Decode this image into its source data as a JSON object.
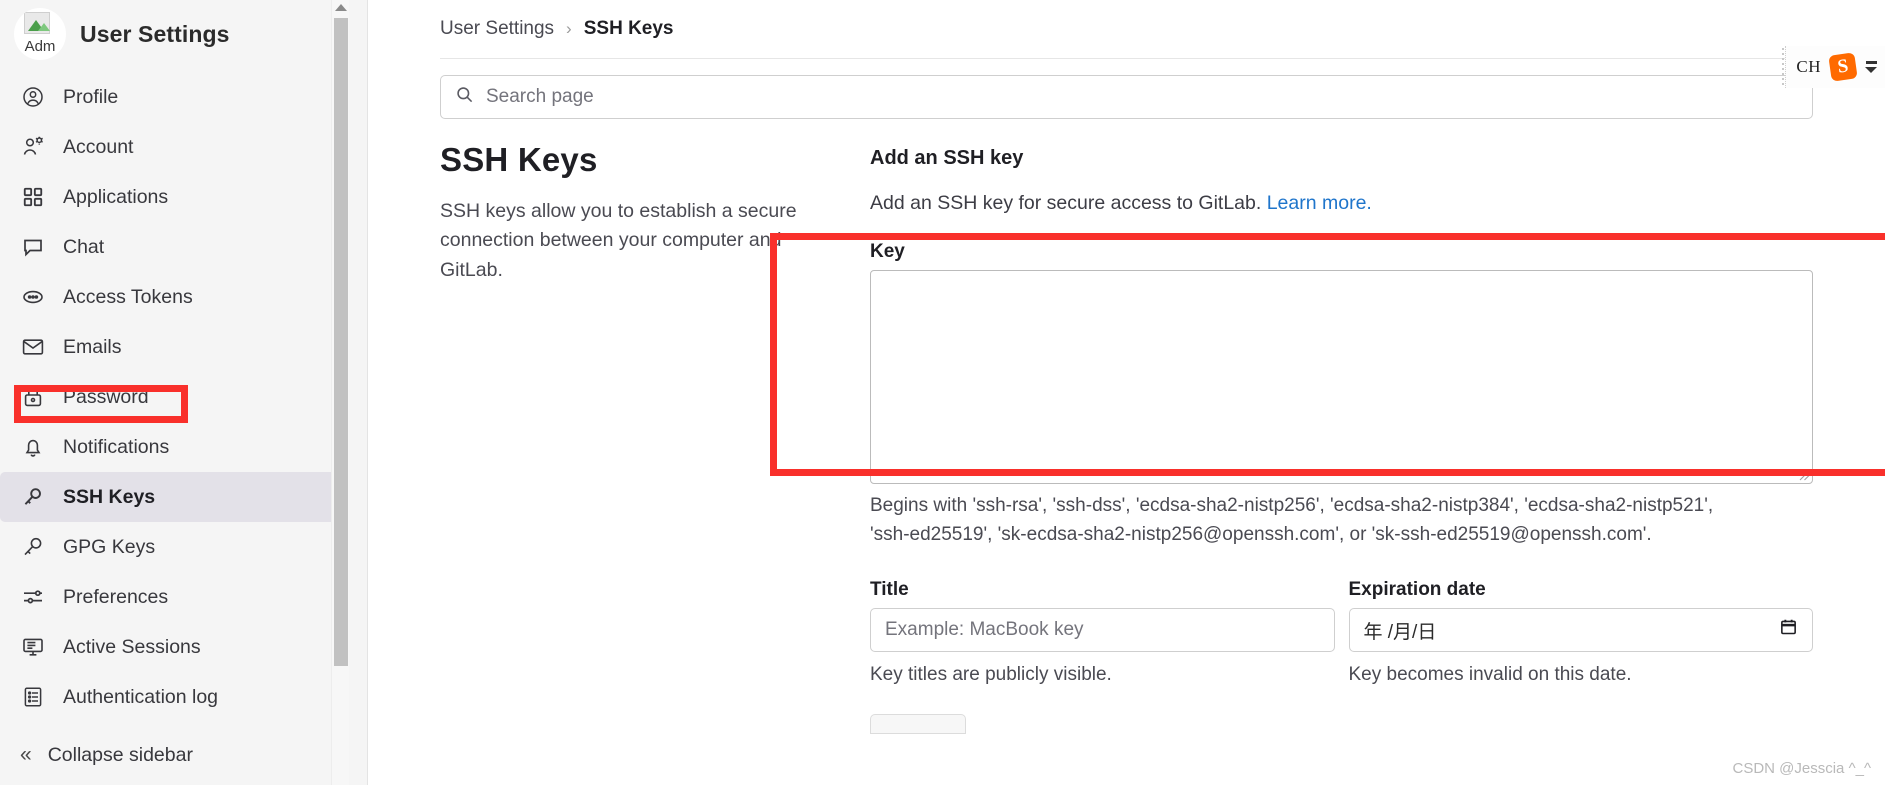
{
  "sidebar": {
    "avatar_alt": "Adm",
    "title": "User Settings",
    "items": [
      {
        "label": "Profile",
        "icon": "user-circle-icon",
        "active": false
      },
      {
        "label": "Account",
        "icon": "user-gear-icon",
        "active": false
      },
      {
        "label": "Applications",
        "icon": "grid-apps-icon",
        "active": false
      },
      {
        "label": "Chat",
        "icon": "chat-bubble-icon",
        "active": false
      },
      {
        "label": "Access Tokens",
        "icon": "token-icon",
        "active": false
      },
      {
        "label": "Emails",
        "icon": "envelope-icon",
        "active": false
      },
      {
        "label": "Password",
        "icon": "lock-icon",
        "active": false
      },
      {
        "label": "Notifications",
        "icon": "bell-icon",
        "active": false
      },
      {
        "label": "SSH Keys",
        "icon": "key-icon",
        "active": true
      },
      {
        "label": "GPG Keys",
        "icon": "key-icon",
        "active": false
      },
      {
        "label": "Preferences",
        "icon": "sliders-icon",
        "active": false
      },
      {
        "label": "Active Sessions",
        "icon": "monitor-icon",
        "active": false
      },
      {
        "label": "Authentication log",
        "icon": "list-doc-icon",
        "active": false
      }
    ],
    "collapse_label": "Collapse sidebar",
    "collapse_icon": "chevron-double-left-icon"
  },
  "breadcrumb": {
    "parent": "User Settings",
    "separator": "›",
    "current": "SSH Keys"
  },
  "search": {
    "placeholder": "Search page",
    "icon": "search-icon",
    "value": ""
  },
  "overview": {
    "title": "SSH Keys",
    "description": "SSH keys allow you to establish a secure connection between your computer and GitLab."
  },
  "add_key": {
    "section_title": "Add an SSH key",
    "section_desc": "Add an SSH key for secure access to GitLab.",
    "learn_more": "Learn more.",
    "key_label": "Key",
    "key_value": "",
    "key_help_line1": "Begins with 'ssh-rsa', 'ssh-dss', 'ecdsa-sha2-nistp256', 'ecdsa-sha2-nistp384', 'ecdsa-sha2-nistp521',",
    "key_help_line2": "'ssh-ed25519', 'sk-ecdsa-sha2-nistp256@openssh.com', or 'sk-ssh-ed25519@openssh.com'.",
    "title_label": "Title",
    "title_placeholder": "Example: MacBook key",
    "title_value": "",
    "title_hint": "Key titles are publicly visible.",
    "expiration_label": "Expiration date",
    "expiration_placeholder": "年 /月/日",
    "expiration_value": "",
    "expiration_icon": "calendar-icon",
    "expiration_hint": "Key becomes invalid on this date."
  },
  "browser_chrome": {
    "ime_indicator": "CH",
    "extension_icon": "sogou-icon",
    "extension_label": "S",
    "menu_icon": "more-options-icon"
  },
  "watermark": "CSDN @Jesscia ^_^",
  "colors": {
    "annotation_red": "#f9302b",
    "link_blue": "#1f75cb",
    "sidebar_bg": "#f5f5f5",
    "active_item_bg": "#e3e1e8"
  }
}
